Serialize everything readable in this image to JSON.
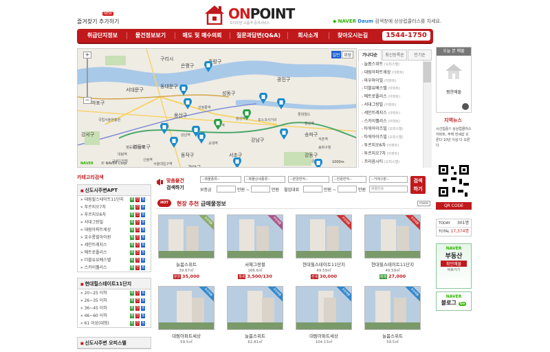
{
  "header": {
    "favorite": "즐겨찾기 추가하기",
    "new_badge": "NEW",
    "logo_on": "ON",
    "logo_point": "POINT",
    "logo_sub": "프리미엄 고품격 중개서비스",
    "naver_label": "NAVER",
    "daum_label": "Daum",
    "naver_text": "검색창에 상상럽콜러스를 치세요."
  },
  "nav": {
    "items": [
      "취급단지정보",
      "물건정보보기",
      "매도 및 매수의뢰",
      "질문과답변(Q&A)",
      "회사소개",
      "찾아오시는길"
    ],
    "phone": "1544-1750"
  },
  "map": {
    "btn_normal": "일반",
    "btn_satellite": "위성",
    "copyright": "© NAVER Corp.",
    "naver_logo": "NAVER",
    "scale": "1000m",
    "labels": [
      "구리시",
      "은평구",
      "중랑구",
      "서대문구",
      "동대문구",
      "마포구",
      "강서구",
      "성동구",
      "광진구",
      "용산구",
      "영등포구",
      "강남구",
      "송파구",
      "동작구",
      "서초구",
      "관악구",
      "강동구",
      "선정릉역",
      "삼성역",
      "강남역",
      "선릉역",
      "포스코사거리",
      "잠실역",
      "석촌역",
      "문정역",
      "대림역",
      "신림역",
      "송파구청",
      "롯데월드",
      "영등포구청역",
      "구로디지털",
      "국립서울현충원",
      "서울대입구역",
      "교대역"
    ],
    "tabs": [
      "가나다순",
      "최신등록순",
      "인기순"
    ],
    "list": [
      {
        "name": "늘봄스위트",
        "type": "(오피스텔)"
      },
      {
        "name": "대림아파트세상",
        "type": "(아파트)"
      },
      {
        "name": "마우마이빌",
        "type": "(아파트)"
      },
      {
        "name": "더블유베스텔",
        "type": "(아파트)"
      },
      {
        "name": "메트로폴리스",
        "type": "(아파트)"
      },
      {
        "name": "서대그랑빌",
        "type": "(아파트)"
      },
      {
        "name": "세인트레지스",
        "type": "(아파트)"
      },
      {
        "name": "스카이팰리스",
        "type": "(아파트)"
      },
      {
        "name": "타워아이즈빌",
        "type": "(오피스텔)"
      },
      {
        "name": "타워아이즈빌",
        "type": "(오피스텔)"
      },
      {
        "name": "투르지오6차",
        "type": "(아파트)"
      },
      {
        "name": "투르지오7차",
        "type": "(아파트)"
      },
      {
        "name": "프라움시티",
        "type": "(오피스텔)"
      }
    ]
  },
  "category": {
    "title": "카테고리검색",
    "groups": [
      {
        "head": "신도시주변APT",
        "items": [
          "대림힐스테이트11단지",
          "푸르지오7차",
          "푸르지오6차",
          "서대그랑빌",
          "대림아파트세상",
          "호수롱힐아이원",
          "세인트레지스",
          "메트로폴리스",
          "더블유유베스텔",
          "스카이팰리스"
        ]
      },
      {
        "head": "현대힐스테이트11단지",
        "items": [
          "20~25 이하",
          "26~35 이하",
          "36~45 이하",
          "46~60 이하",
          "61 이상(대형)"
        ]
      },
      {
        "head": "신도시주변 오피스텔",
        "items": []
      }
    ],
    "badges": [
      "매",
      "전",
      "월"
    ]
  },
  "search": {
    "title_top": "맞춤물건",
    "title_bottom": "검색하기",
    "selects": [
      "--매물종류--",
      "--매물상세종류--",
      "--분양면적--",
      "--전용면적--",
      "--거래구분--"
    ],
    "labels": [
      "보증금",
      "만원 ~",
      "만원",
      "월임대료",
      "만원 ~",
      "만원",
      "매물번호"
    ],
    "button": "검색하기"
  },
  "recommend": {
    "hot": "HOT",
    "title_em": "현장 추천",
    "title": "급매물정보",
    "more": "more",
    "cards": [
      {
        "title": "늘봄스위트",
        "area": "39.67㎡",
        "tag": "분양",
        "price": "35,000",
        "ribbon": "추천매물",
        "color": "#8a6"
      },
      {
        "title": "서해그랑블",
        "area": "166.6㎡",
        "tag": "월세",
        "price": "3,500/130",
        "ribbon": "추천매물",
        "color": "#a58"
      },
      {
        "title": "현대힐스테이트11단지",
        "area": "49.59㎡",
        "tag": "전세",
        "price": "30,000",
        "ribbon": "추천매물",
        "color": "#c33"
      },
      {
        "title": "현대힐스테이트11단지",
        "area": "49.59㎡",
        "tag": "매매",
        "price": "27,000",
        "ribbon": "추천매물",
        "color": "#c33"
      },
      {
        "title": "대림아파트세상",
        "area": "59.5㎡",
        "tag": "",
        "price": "",
        "ribbon": "추천매물",
        "color": "#38c"
      },
      {
        "title": "늘봄스위트",
        "area": "62.81㎡",
        "tag": "",
        "price": "",
        "ribbon": "추천매물",
        "color": "#38c"
      },
      {
        "title": "대림아파트세상",
        "area": "104.13㎡",
        "tag": "",
        "price": "",
        "ribbon": "추천매물",
        "color": "#38c"
      },
      {
        "title": "늘봄스위트",
        "area": "59.5㎡",
        "tag": "",
        "price": "",
        "ribbon": "추천매물",
        "color": "#38c"
      }
    ]
  },
  "right": {
    "recent_title": "오늘 본 매물",
    "recent_sub": "찜한매물",
    "news_title": "지역뉴스",
    "news_text": "시선집중!! 상상럽클러스 아파트, 주택 전세값 오른다 10년 이상 다 오른다",
    "qr_label": "QR CODE",
    "today_label": "TODAY",
    "today_value": "301명",
    "total_label": "TOTAL",
    "total_value": "17,374명",
    "naver_banner_top": "NAVER",
    "naver_banner_mid": "부동산",
    "naver_banner_low": "확인매물",
    "naver_banner_btn": "바로가기",
    "blog_top": "NAVER",
    "blog_bottom": "블로그",
    "blog_btn": "Go"
  }
}
